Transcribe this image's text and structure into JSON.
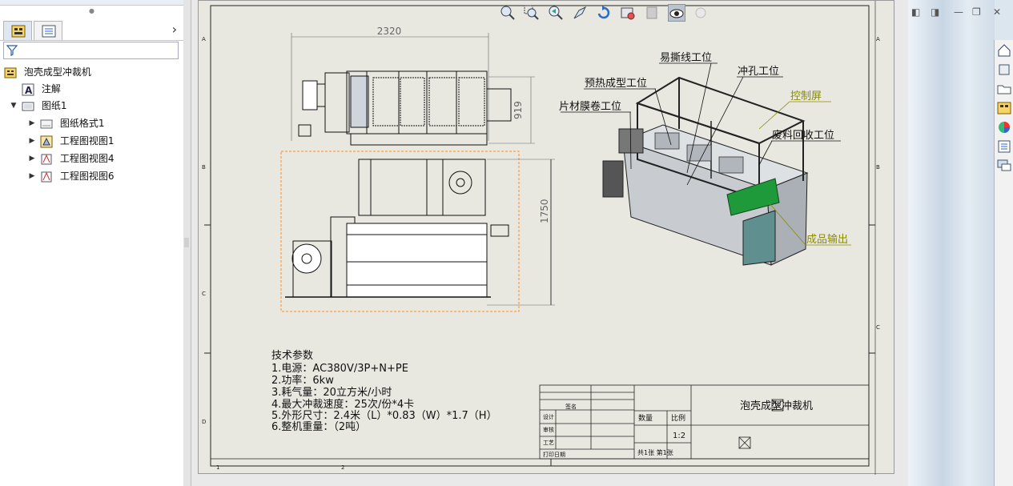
{
  "feature_tree": {
    "root_label": "泡壳成型冲裁机",
    "items": [
      {
        "label": "注解"
      },
      {
        "label": "图纸1"
      },
      {
        "label": "图纸格式1"
      },
      {
        "label": "工程图视图1"
      },
      {
        "label": "工程图视图4"
      },
      {
        "label": "工程图视图6"
      }
    ]
  },
  "drawing": {
    "dims": {
      "width": "2320",
      "depth": "919",
      "height": "1750"
    },
    "callouts": {
      "tear": "易撕线工位",
      "punch": "冲孔工位",
      "preheat": "预热成型工位",
      "control": "控制屏",
      "film": "片材膜卷工位",
      "waste": "废料回收工位",
      "output": "成品输出"
    },
    "specs": {
      "title": "技术参数",
      "lines": [
        "1.电源：AC380V/3P+N+PE",
        "2.功率：6kw",
        "3.耗气量：20立方米/小时",
        "4.最大冲裁速度：25次/份*4卡",
        "5.外形尺寸：2.4米（L）*0.83（W）*1.7（H）",
        "6.整机重量：（2吨）"
      ]
    },
    "title_block": {
      "name": "泡壳成型冲裁机",
      "sign": "签名",
      "design": "设计",
      "audit": "审核",
      "process": "工艺",
      "print_date": "打印日期",
      "qty": "数量",
      "scale_label": "比例",
      "scale": "1:2",
      "sheets": "共1张 第1张"
    },
    "border_letters": [
      "A",
      "B",
      "C",
      "D"
    ],
    "border_numbers": [
      "1",
      "2"
    ]
  },
  "colors": {
    "sheet_bg": "#e8e8e1",
    "callout_olive": "#8b8b00",
    "selection_orange": "#ff8c1a",
    "green_output": "#1f9a3a"
  }
}
